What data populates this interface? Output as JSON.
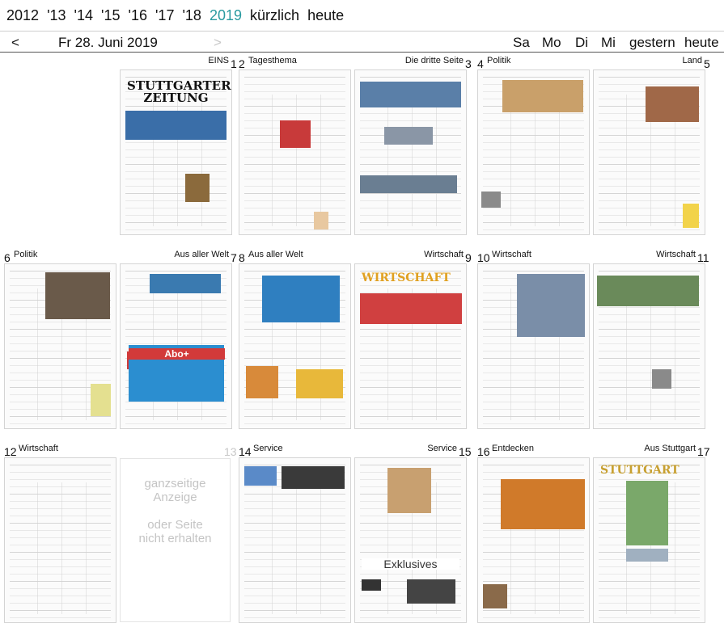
{
  "years": [
    "2012",
    "'13",
    "'14",
    "'15",
    "'16",
    "'17",
    "'18",
    "2019",
    "kürzlich",
    "heute"
  ],
  "nav": {
    "prev": "<",
    "date": "Fr 28. Juni 2019",
    "next": ">",
    "days": [
      "Sa",
      "Mo",
      "Di",
      "Mi",
      "gestern",
      "heute"
    ]
  },
  "spreads": [
    {
      "left": {
        "num": "",
        "label": ""
      },
      "right": {
        "num": "1",
        "label": "EINS"
      }
    },
    {
      "left": {
        "num": "2",
        "label": "Tagesthema"
      },
      "right": {
        "num": "3",
        "label": "Die dritte Seite"
      }
    },
    {
      "left": {
        "num": "4",
        "label": "Politik"
      },
      "right": {
        "num": "5",
        "label": "Land"
      }
    },
    {
      "left": {
        "num": "6",
        "label": "Politik"
      },
      "right": {
        "num": "7",
        "label": "Aus aller Welt"
      }
    },
    {
      "left": {
        "num": "8",
        "label": "Aus aller Welt"
      },
      "right": {
        "num": "9",
        "label": "Wirtschaft"
      }
    },
    {
      "left": {
        "num": "10",
        "label": "Wirtschaft"
      },
      "right": {
        "num": "11",
        "label": "Wirtschaft"
      }
    },
    {
      "left": {
        "num": "12",
        "label": "Wirtschaft"
      },
      "right": {
        "num": "13",
        "label": ""
      }
    },
    {
      "left": {
        "num": "14",
        "label": "Service"
      },
      "right": {
        "num": "15",
        "label": "Service"
      }
    },
    {
      "left": {
        "num": "16",
        "label": "Entdecken"
      },
      "right": {
        "num": "17",
        "label": "Aus Stuttgart"
      }
    }
  ],
  "page_texts": {
    "p1_masthead": "STUTTGARTER ZEITUNG",
    "p9_masthead": "WIRTSCHAFT",
    "p15_ad": "Exklusives",
    "p17_masthead": "STUTTGART",
    "p7_badge": "Abo+"
  },
  "missing_page": {
    "line1": "ganzseitige",
    "line2": "Anzeige",
    "line3": "oder Seite",
    "line4": "nicht erhalten"
  },
  "colors": {
    "active_year": "#2a9aa0",
    "inactive_arrow": "#c8c8c8",
    "missing_text": "#c4c4c4"
  }
}
